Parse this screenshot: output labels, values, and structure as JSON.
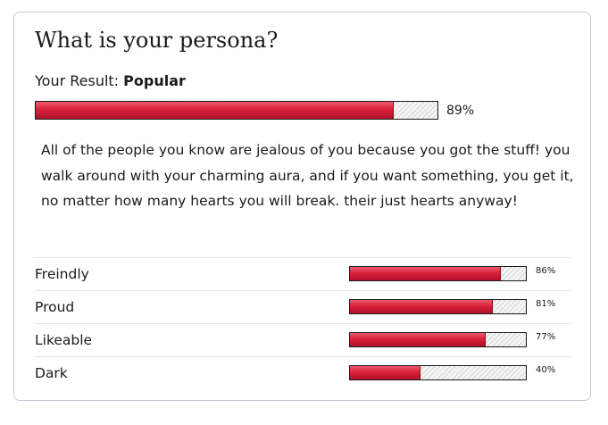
{
  "quiz": {
    "title": "What is your persona?",
    "result_prefix": "Your Result: ",
    "result_name": "Popular",
    "result_percent": 89,
    "result_percent_label": "89%",
    "description": "All of the people you know are jealous of you because you got the stuff! you walk around with your charming aura, and if you want something, you get it, no matter how many hearts you will break. their just hearts anyway!"
  },
  "traits": [
    {
      "label": "Freindly",
      "percent": 86,
      "percent_label": "86%"
    },
    {
      "label": "Proud",
      "percent": 81,
      "percent_label": "81%"
    },
    {
      "label": "Likeable",
      "percent": 77,
      "percent_label": "77%"
    },
    {
      "label": "Dark",
      "percent": 40,
      "percent_label": "40%"
    }
  ],
  "colors": {
    "bar_fill": "#d9213a",
    "bar_border": "#1a1a1a",
    "card_border": "#c9c9d6",
    "text": "#1a1a1a"
  }
}
